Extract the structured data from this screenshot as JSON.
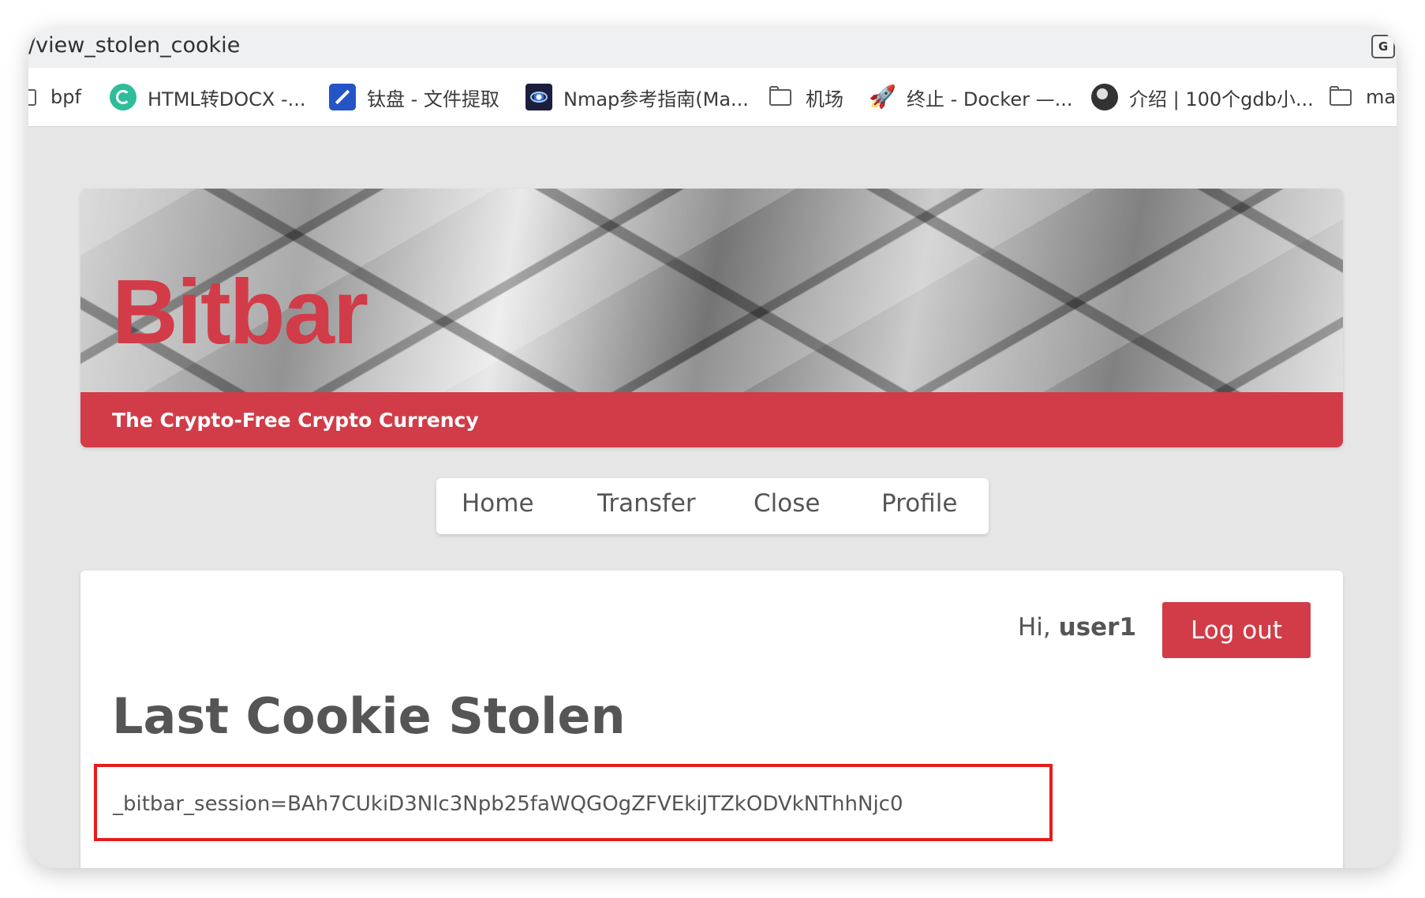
{
  "browser": {
    "url": "/view_stolen_cookie",
    "translate_icon": "translate-icon",
    "bookmarks": [
      {
        "label": "bpf",
        "icon": "folder-icon"
      },
      {
        "label": "HTML转DOCX -...",
        "icon": "cycle-icon"
      },
      {
        "label": "钛盘 - 文件提取",
        "icon": "titanium-disk-icon"
      },
      {
        "label": "Nmap参考指南(Ma...",
        "icon": "eye-icon"
      },
      {
        "label": "机场",
        "icon": "folder-icon"
      },
      {
        "label": "终止 - Docker —...",
        "icon": "rocket-icon"
      },
      {
        "label": "介绍 | 100个gdb小...",
        "icon": "globe-icon"
      },
      {
        "label": "ma",
        "icon": "folder-icon"
      }
    ]
  },
  "banner": {
    "logo": "Bitbar",
    "tagline": "The Crypto-Free Crypto Currency",
    "accent_color": "#d13c48"
  },
  "nav": {
    "items": [
      "Home",
      "Transfer",
      "Close",
      "Profile"
    ]
  },
  "session": {
    "greeting_prefix": "Hi, ",
    "username": "user1",
    "logout_label": "Log out"
  },
  "content": {
    "heading": "Last Cookie Stolen",
    "cookie": "_bitbar_session=BAh7CUkiD3Nlc3Npb25faWQGOgZFVEkiJTZkODVkNThhNjc0",
    "highlight_color": "#e51c1c"
  }
}
